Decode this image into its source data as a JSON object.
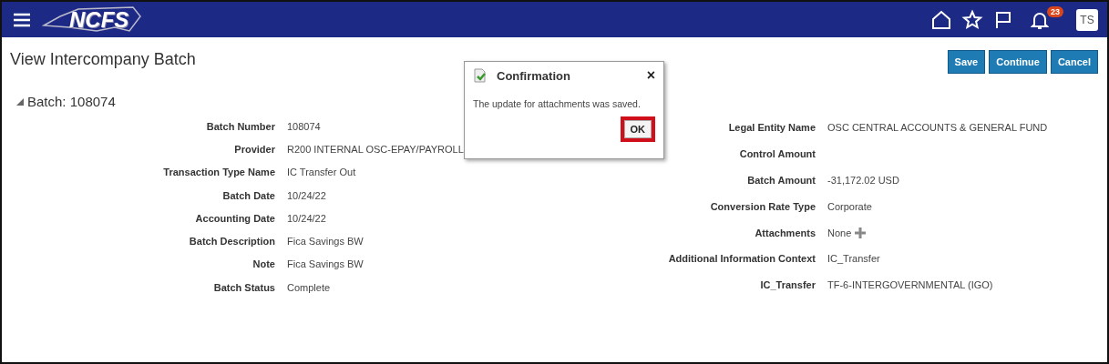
{
  "header": {
    "logo": "NCFS",
    "notifications_badge": "23",
    "avatar": "TS"
  },
  "page": {
    "title": "View Intercompany Batch",
    "buttons": [
      "Save",
      "Continue",
      "Cancel"
    ]
  },
  "section": {
    "title": "Batch: 108074",
    "expanded": true
  },
  "left_fields": [
    {
      "label": "Batch Number",
      "value": "108074"
    },
    {
      "label": "Provider",
      "value": "R200 INTERNAL OSC-EPAY/PAYROLL"
    },
    {
      "label": "Transaction Type Name",
      "value": "IC Transfer Out"
    },
    {
      "label": "Batch Date",
      "value": "10/24/22"
    },
    {
      "label": "Accounting Date",
      "value": "10/24/22"
    },
    {
      "label": "Batch Description",
      "value": "Fica Savings BW"
    },
    {
      "label": "Note",
      "value": "Fica Savings BW"
    },
    {
      "label": "Batch Status",
      "value": "Complete"
    }
  ],
  "right_fields": [
    {
      "label": "Legal Entity Name",
      "value": "OSC CENTRAL ACCOUNTS & GENERAL FUND"
    },
    {
      "label": "Control Amount"
    },
    {
      "label": "Batch Amount",
      "value": "-31,172.02 USD"
    },
    {
      "label": "Conversion Rate Type",
      "value": "Corporate"
    },
    {
      "label": "Attachments",
      "value": "None",
      "kind": "attachments"
    },
    {
      "label": "Additional Information Context",
      "value": "IC_Transfer"
    },
    {
      "label": "IC_Transfer",
      "value": "TF-6-INTERGOVERNMENTAL (IGO)"
    }
  ],
  "dialog": {
    "title": "Confirmation",
    "close": "×",
    "message": "The update for attachments was saved.",
    "button": {
      "label": "OK",
      "highlighted": true
    }
  }
}
